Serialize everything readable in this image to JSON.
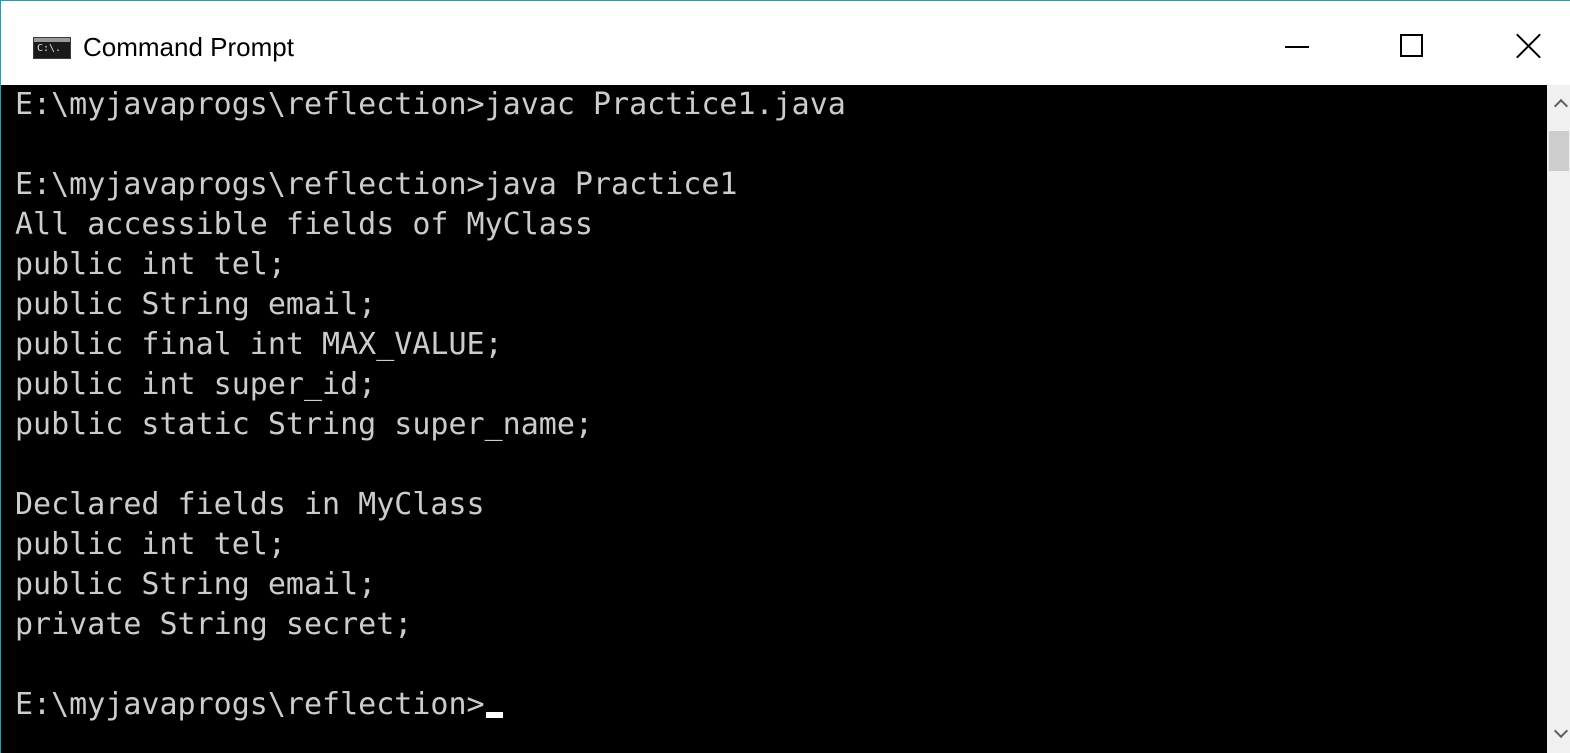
{
  "window": {
    "title": "Command Prompt",
    "icon": "cmd-icon",
    "icon_text": "C:\\.",
    "controls": {
      "minimize": "minimize-icon",
      "maximize": "maximize-icon",
      "close": "close-icon"
    }
  },
  "console": {
    "lines": [
      "E:\\myjavaprogs\\reflection>javac Practice1.java",
      "",
      "E:\\myjavaprogs\\reflection>java Practice1",
      "All accessible fields of MyClass",
      "public int tel;",
      "public String email;",
      "public final int MAX_VALUE;",
      "public int super_id;",
      "public static String super_name;",
      "",
      "Declared fields in MyClass",
      "public int tel;",
      "public String email;",
      "private String secret;",
      "",
      "E:\\myjavaprogs\\reflection>"
    ],
    "colors": {
      "background": "#000000",
      "text": "#cccccc",
      "cursor": "#ffffff"
    }
  },
  "scrollbar": {
    "up_icon": "chevron-up-icon",
    "down_icon": "chevron-down-icon"
  }
}
